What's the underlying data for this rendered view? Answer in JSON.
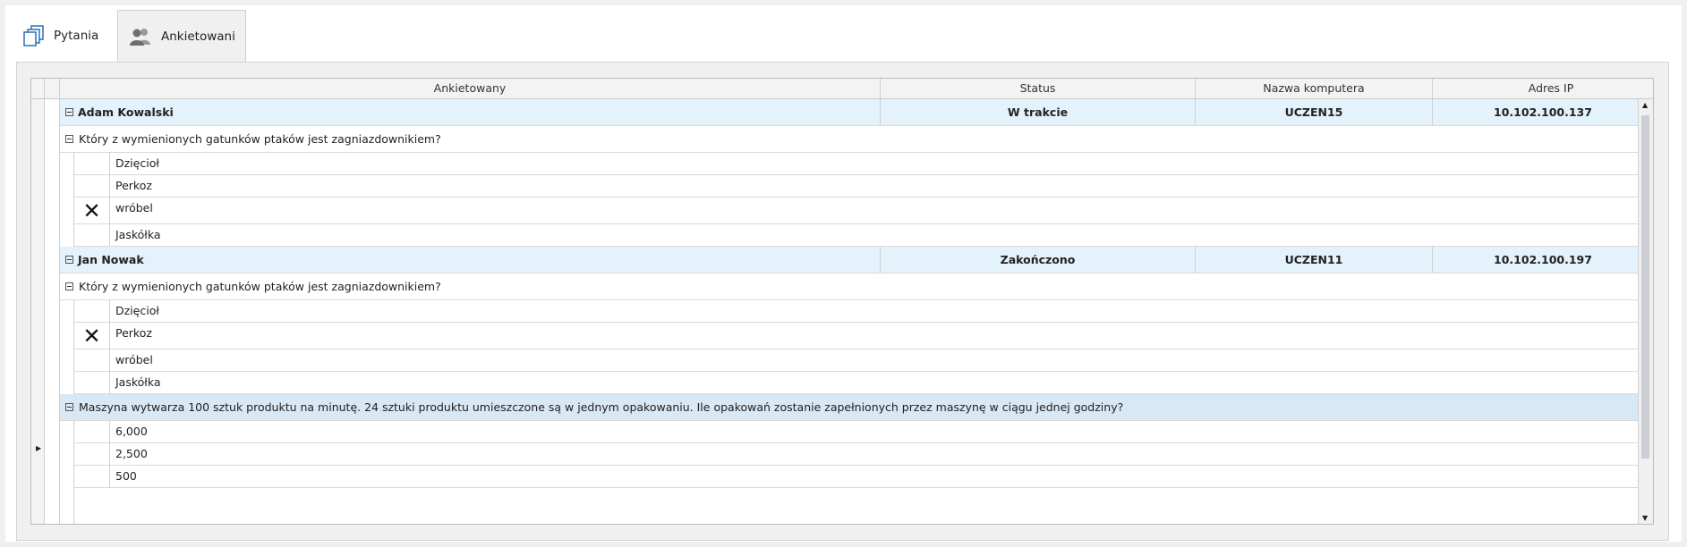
{
  "tabs": [
    {
      "label": "Pytania",
      "icon": "pages-icon"
    },
    {
      "label": "Ankietowani",
      "icon": "users-icon",
      "active": true
    }
  ],
  "columns": {
    "respondent": "Ankietowany",
    "status": "Status",
    "computer": "Nazwa komputera",
    "ip": "Adres IP"
  },
  "respondents": [
    {
      "name": "Adam Kowalski",
      "status": "W trakcie",
      "computer": "UCZEN15",
      "ip": "10.102.100.137",
      "question": "Który z wymienionych gatunków ptaków jest zagniazdownikiem?",
      "options": [
        "Dzięcioł",
        "Perkoz",
        "wróbel",
        "Jaskółka"
      ],
      "selected_index": 2
    },
    {
      "name": "Jan Nowak",
      "status": "Zakończono",
      "computer": "UCZEN11",
      "ip": "10.102.100.197",
      "question": "Który z wymienionych gatunków ptaków jest zagniazdownikiem?",
      "options": [
        "Dzięcioł",
        "Perkoz",
        "wróbel",
        "Jaskółka"
      ],
      "selected_index": 1,
      "question2": "Maszyna wytwarza 100 sztuk produktu na minutę. 24 sztuki produktu umieszczone są w jednym opakowaniu. Ile opakowań zostanie zapełnionych przez maszynę w ciągu jednej godziny?",
      "options2": [
        "6,000",
        "2,500",
        "500"
      ]
    }
  ],
  "selected_mark": "✕",
  "colors": {
    "group_row": "#e4f2fb",
    "selected_row": "#d8e8f4"
  }
}
